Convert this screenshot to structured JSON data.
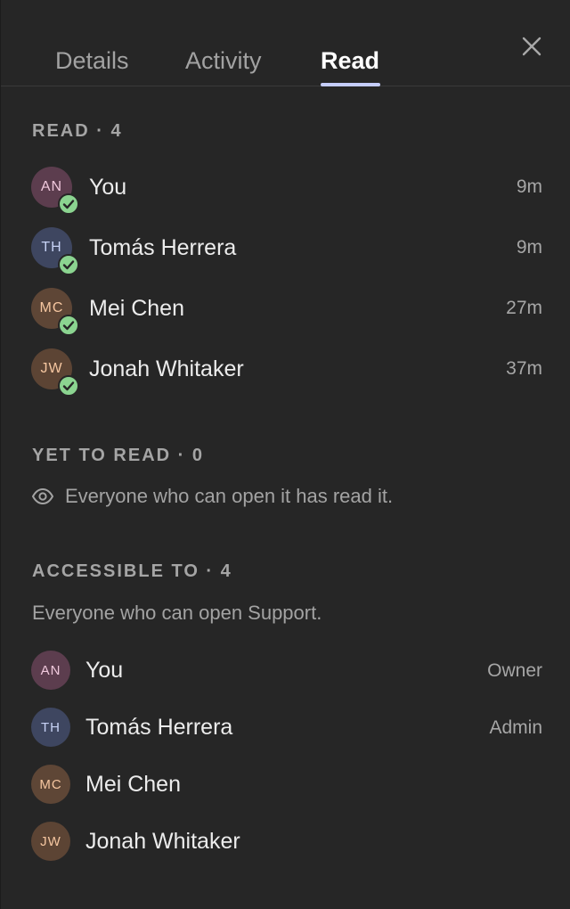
{
  "tabs": [
    {
      "label": "Details"
    },
    {
      "label": "Activity"
    },
    {
      "label": "Read"
    }
  ],
  "active_tab": "Read",
  "read_section": {
    "heading": "READ · 4",
    "people": [
      {
        "initials": "AN",
        "name": "You",
        "time": "9m"
      },
      {
        "initials": "TH",
        "name": "Tomás Herrera",
        "time": "9m"
      },
      {
        "initials": "MC",
        "name": "Mei Chen",
        "time": "27m"
      },
      {
        "initials": "JW",
        "name": "Jonah Whitaker",
        "time": "37m"
      }
    ]
  },
  "yet_to_read": {
    "heading": "YET TO READ · 0",
    "message": "Everyone who can open it has read it."
  },
  "accessible": {
    "heading": "ACCESSIBLE TO · 4",
    "description": "Everyone who can open Support.",
    "people": [
      {
        "initials": "AN",
        "name": "You",
        "role": "Owner"
      },
      {
        "initials": "TH",
        "name": "Tomás Herrera",
        "role": "Admin"
      },
      {
        "initials": "MC",
        "name": "Mei Chen",
        "role": ""
      },
      {
        "initials": "JW",
        "name": "Jonah Whitaker",
        "role": ""
      }
    ]
  },
  "colors": {
    "background": "#262626",
    "active_tab_underline": "#c5cdfb",
    "read_check": "#8bd490"
  }
}
